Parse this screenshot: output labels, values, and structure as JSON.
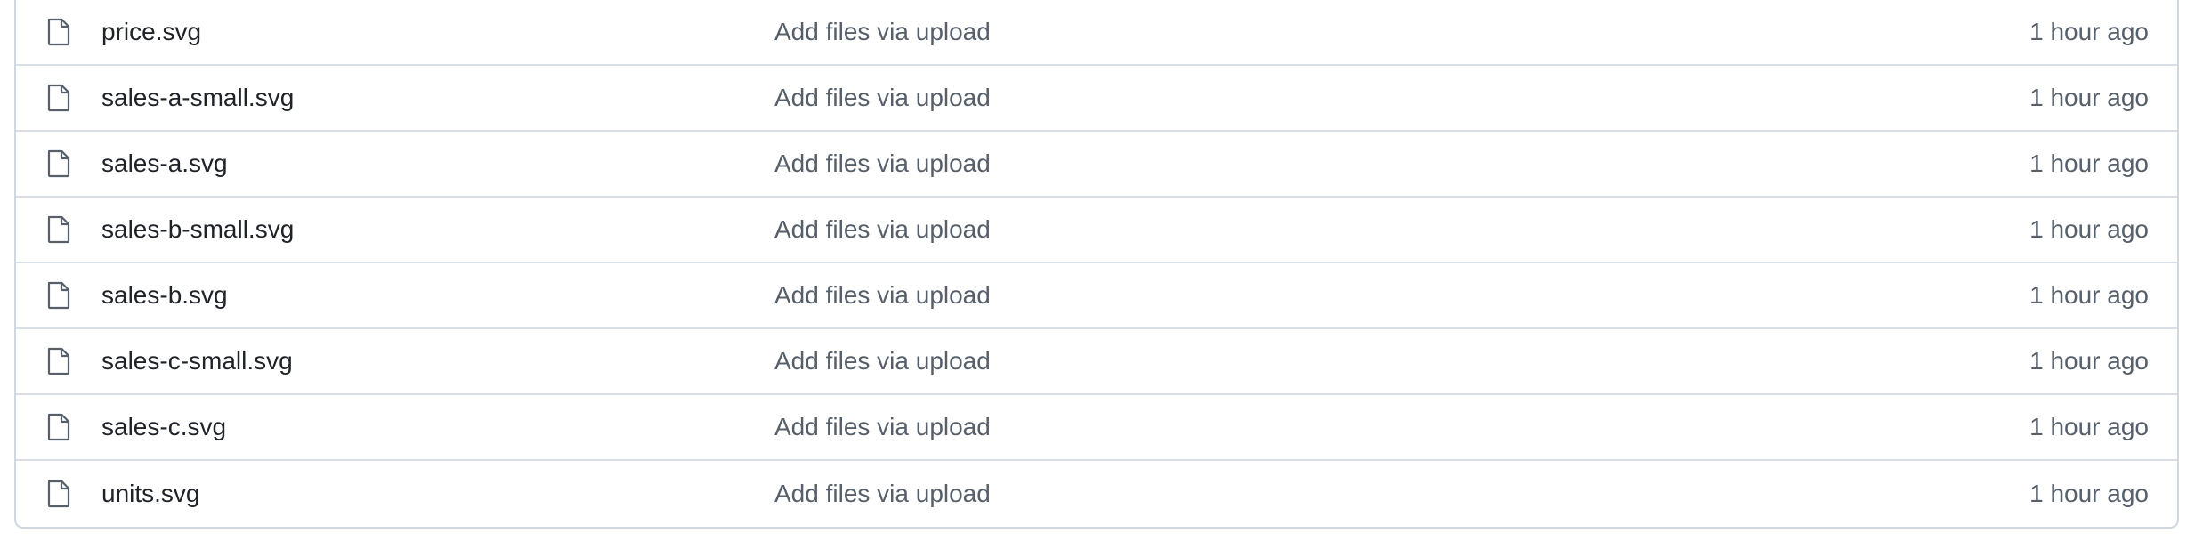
{
  "files": [
    {
      "icon": "file-icon",
      "name": "price.svg",
      "message": "Add files via upload",
      "age": "1 hour ago"
    },
    {
      "icon": "file-icon",
      "name": "sales-a-small.svg",
      "message": "Add files via upload",
      "age": "1 hour ago"
    },
    {
      "icon": "file-icon",
      "name": "sales-a.svg",
      "message": "Add files via upload",
      "age": "1 hour ago"
    },
    {
      "icon": "file-icon",
      "name": "sales-b-small.svg",
      "message": "Add files via upload",
      "age": "1 hour ago"
    },
    {
      "icon": "file-icon",
      "name": "sales-b.svg",
      "message": "Add files via upload",
      "age": "1 hour ago"
    },
    {
      "icon": "file-icon",
      "name": "sales-c-small.svg",
      "message": "Add files via upload",
      "age": "1 hour ago"
    },
    {
      "icon": "file-icon",
      "name": "sales-c.svg",
      "message": "Add files via upload",
      "age": "1 hour ago"
    },
    {
      "icon": "file-icon",
      "name": "units.svg",
      "message": "Add files via upload",
      "age": "1 hour ago"
    }
  ],
  "colors": {
    "text_primary": "#1f2328",
    "text_muted": "#57606a",
    "border": "#d0d7de"
  }
}
